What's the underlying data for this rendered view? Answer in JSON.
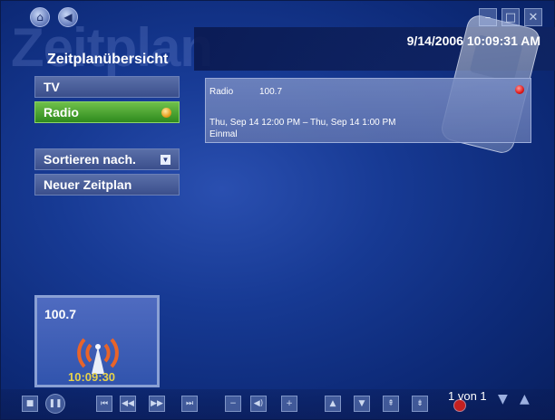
{
  "header": {
    "watermark": "Zeitplan",
    "title": "Zeitplanübersicht",
    "datetime": "9/14/2006 10:09:31 AM"
  },
  "nav": {
    "home_icon": "home-icon",
    "back_icon": "back-icon"
  },
  "window": {
    "minimize": "–",
    "maximize": "□",
    "close": "✕"
  },
  "menu": {
    "tv": "TV",
    "radio": "Radio",
    "sort": "Sortieren nach.",
    "new_schedule": "Neuer Zeitplan"
  },
  "schedule": {
    "channel": "Radio",
    "frequency": "100.7",
    "time": "Thu, Sep 14 12:00 PM – Thu, Sep 14 1:00 PM",
    "recurrence": "Einmal"
  },
  "preview": {
    "frequency": "100.7",
    "clock": "10:09:30"
  },
  "pager": {
    "text": "1 von 1"
  },
  "colors": {
    "accent_green": "#3c9a2a",
    "record_red": "#e01818",
    "clock_yellow": "#e6d24a"
  }
}
